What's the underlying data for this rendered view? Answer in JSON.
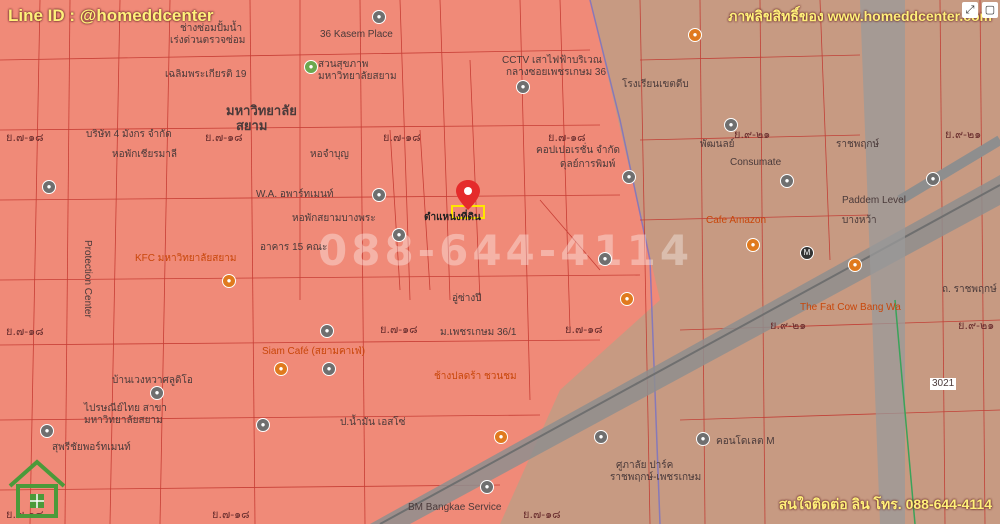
{
  "header": {
    "line_id": "Line ID : @homeddcenter",
    "credit": "ภาพลิขสิทธิ์ของ www.homeddcenter.com"
  },
  "footer": {
    "contact": "สนใจติดต่อ ลิน โทร. 088-644-4114"
  },
  "watermark": "088-644-4114",
  "colors": {
    "zone_red": "#f08a78",
    "zone_brown": "#c79a82",
    "road": "#8e8e8e",
    "accent": "#fff07a"
  },
  "map_controls": [
    "expand-icon",
    "fullscreen-icon"
  ],
  "zone_codes": {
    "red": "ย.๗-๑๘",
    "brown": "ย.๙-๒๑"
  },
  "places": [
    "36 Kasem Place",
    "ช่างซ่อมปั้มน้ำ",
    "เร่งด่วนตรวจซ่อม",
    "เฉลิมพระเกียรติ 19",
    "สวนสุขภาพ",
    "มหาวิทยาลัยสยาม",
    "มหาวิทยาลัย",
    "สยาม",
    "บริษัท 4 มังกร จำกัด",
    "หอพักเชียรมาลี",
    "หอจำบุญ",
    "W.A. อพาร์ทเมนท์",
    "หอพักสยามบางพระ",
    "อาคาร 15 คณะ",
    "ตำแหน่งที่ดิน",
    "KFC มหาวิทยาลัยสยาม",
    "CCTV เสาไฟฟ้าบริเวณ",
    "กลางซอยเพชรเกษม 36",
    "คอปเปอเรชั่น จำกัด",
    "ดุลย์การพิมพ์",
    "อู่ซ่างปี",
    "ม.เพชรเกษม 36/1",
    "Siam Café (สยามคาเฟ่)",
    "ป.น้ำมัน เอสโซ่",
    "ช้างปลดร้า ชวนชม",
    "บ้านเวงหวาศลูดิโอ",
    "ไปรษณีย์ไทย สาขา",
    "มหาวิทยาลัยสยาม",
    "สุพรีชัยพอร์ทเมนท์",
    "BM Bangkae Service",
    "ศูภาลัย ปาร์ค",
    "ราชพฤกษ์-เพชรเกษม",
    "คอนโดเลต M",
    "Consumate",
    "Cafe Amazon",
    "Paddem Level",
    "The Fat Cow Bang Wa",
    "บางหว้า",
    "โรงเรียนเขตดีบ",
    "พัฒนลย์",
    "ราชพฤกษ์",
    "3021",
    "ถ. ราชพฤกษ์",
    "Protection Center"
  ]
}
